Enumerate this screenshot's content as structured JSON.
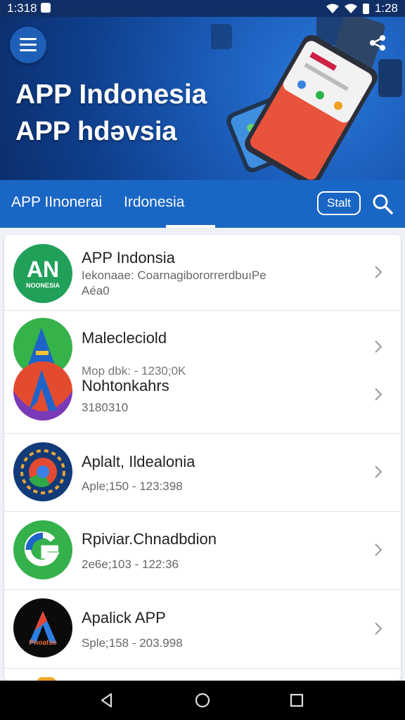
{
  "status_bar": {
    "time_left": "1:318",
    "time_right": "1:28"
  },
  "hero": {
    "title": "APP Indonesia",
    "subtitle": "APP hdəvsia"
  },
  "tabs": {
    "tab1": "APP IInonerai",
    "tab2": "Irdonesia",
    "start_label": "Stalt"
  },
  "list": [
    {
      "title": "APP Indonsia",
      "line2": "Iekonaae: CoarnagibororrerdbuıPe",
      "line3": "Aéa0",
      "icon_text": "AN",
      "icon_sub": "NOONESIA"
    },
    {
      "title": "Malecleciold",
      "line2": "Mop dbk: - 1230;0K"
    },
    {
      "title": "Nohtonkahrs",
      "line2": "3180310"
    },
    {
      "title": "Aplalt, Ildealonia",
      "line2": "Aple;150 - 123:398"
    },
    {
      "title": "Rpiviar.Chnadbdion",
      "line2": "2e6e;103 - 122:36"
    },
    {
      "title": "Apalick APP",
      "line2": "Sple;158 - 203.998",
      "icon_text": "Pnoatse"
    }
  ],
  "colors": {
    "primary": "#1a66c4",
    "header_dark": "#0f2f66"
  }
}
